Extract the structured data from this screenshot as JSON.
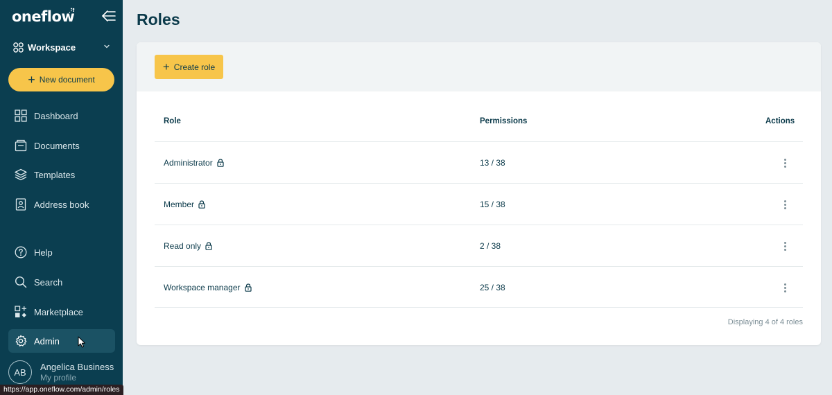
{
  "app": {
    "brand": "oneflow",
    "accent_color": "#f7c54a",
    "sidebar_color": "#0b3e50"
  },
  "sidebar": {
    "workspace_label": "Workspace",
    "new_document_label": "New document",
    "items": [
      {
        "label": "Dashboard",
        "icon": "grid-icon"
      },
      {
        "label": "Documents",
        "icon": "documents-icon"
      },
      {
        "label": "Templates",
        "icon": "layers-icon"
      },
      {
        "label": "Address book",
        "icon": "contact-book-icon"
      },
      {
        "label": "Help",
        "icon": "help-icon"
      },
      {
        "label": "Search",
        "icon": "search-icon"
      },
      {
        "label": "Marketplace",
        "icon": "marketplace-icon"
      },
      {
        "label": "Admin",
        "icon": "gear-icon",
        "active": true
      }
    ],
    "profile": {
      "initials": "AB",
      "name": "Angelica Business",
      "subtitle": "My profile"
    }
  },
  "main": {
    "title": "Roles",
    "create_role_label": "Create role",
    "columns": {
      "role": "Role",
      "permissions": "Permissions",
      "actions": "Actions"
    },
    "rows": [
      {
        "role": "Administrator",
        "permissions": "13 / 38"
      },
      {
        "role": "Member",
        "permissions": "15 / 38"
      },
      {
        "role": "Read only",
        "permissions": "2 / 38"
      },
      {
        "role": "Workspace manager",
        "permissions": "25 / 38"
      }
    ],
    "footer": "Displaying 4 of 4 roles"
  },
  "status_bar": {
    "url": "https://app.oneflow.com/admin/roles"
  }
}
